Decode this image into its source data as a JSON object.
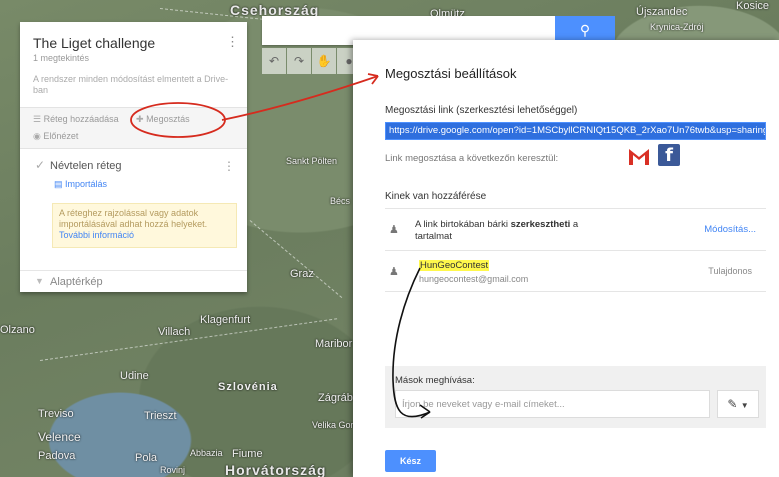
{
  "map": {
    "labels": [
      "Csehország",
      "Olmütz",
      "Újszandec",
      "Kosice",
      "Krynica-Zdrój",
      "Sankt Pölten",
      "Bécs",
      "Graz",
      "Klagenfurt",
      "Maribor",
      "Villach",
      "Udine",
      "Szlovénia",
      "Zágráb",
      "Velika Gorica",
      "Olzano",
      "Treviso",
      "Trieszt",
      "Velence",
      "Padova",
      "Pola",
      "Abbazia",
      "Fiume",
      "Rovinj",
      "Horvátország"
    ],
    "search_button_icon": "search-icon",
    "tools": [
      "undo-icon",
      "redo-icon",
      "hand-icon",
      "marker-icon"
    ]
  },
  "left_panel": {
    "title": "The Liget challenge",
    "subtitle": "1 megtekintés",
    "saved_notice": "A rendszer minden módosítást elmentett a Drive-ban",
    "add_layer": "Réteg hozzáadása",
    "share": "Megosztás",
    "preview": "Előnézet",
    "layer_name": "Névtelen réteg",
    "import": "Importálás",
    "layer_note": "A réteghez rajzolással vagy adatok importálásával adhat hozzá helyeket.",
    "more_info": "További információ",
    "base_map": "Alaptérkép"
  },
  "dialog": {
    "title": "Megosztási beállítások",
    "link_label": "Megosztási link (szerkesztési lehetőséggel)",
    "link_value": "https://drive.google.com/open?id=1MSCbyllCRNIQt15QKB_2rXao7Un76twb&usp=sharing",
    "share_via": "Link megosztása a következőn keresztül:",
    "access_title": "Kinek van hozzáférése",
    "access_row1_pre": "A link birtokában bárki",
    "access_row1_bold": "szerkesztheti",
    "access_row1_post": "a tartalmat",
    "modify": "Módosítás...",
    "owner_name": "HunGeoContest",
    "owner_email": "hungeocontest@gmail.com",
    "owner_role": "Tulajdonos",
    "invite_label": "Mások meghívása:",
    "invite_placeholder": "Írjon be neveket vagy e-mail címeket...",
    "done": "Kész"
  },
  "colors": {
    "accent": "#4d90fe",
    "highlight": "#fff84c",
    "annotation": "#d62b1e",
    "gmail": "#d93025",
    "facebook": "#3b5998"
  }
}
